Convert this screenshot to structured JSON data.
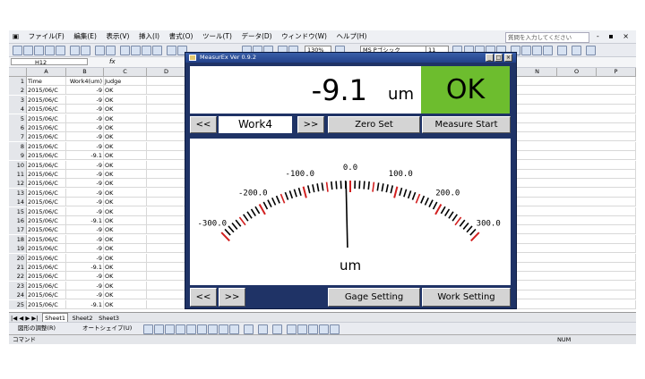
{
  "excel": {
    "menu": [
      "ファイル(F)",
      "編集(E)",
      "表示(V)",
      "挿入(I)",
      "書式(O)",
      "ツール(T)",
      "データ(D)",
      "ウィンドウ(W)",
      "ヘルプ(H)"
    ],
    "help_placeholder": "質問を入力してください",
    "window_controls": "- ▪ ×",
    "zoom": "130%",
    "font_name": "MS Pゴシック",
    "font_size": "11",
    "name_box": "H12",
    "fx_label": "fx",
    "columns": [
      "A",
      "B",
      "C",
      "D",
      "N",
      "O",
      "P"
    ],
    "rows": [
      {
        "n": "1",
        "a": "Time",
        "b": "Work4(um)",
        "c": "Judge"
      },
      {
        "n": "2",
        "a": "2015/06/C",
        "b": "-9",
        "c": "OK"
      },
      {
        "n": "3",
        "a": "2015/06/C",
        "b": "-9",
        "c": "OK"
      },
      {
        "n": "4",
        "a": "2015/06/C",
        "b": "-9",
        "c": "OK"
      },
      {
        "n": "5",
        "a": "2015/06/C",
        "b": "-9",
        "c": "OK"
      },
      {
        "n": "6",
        "a": "2015/06/C",
        "b": "-9",
        "c": "OK"
      },
      {
        "n": "7",
        "a": "2015/06/C",
        "b": "-9",
        "c": "OK"
      },
      {
        "n": "8",
        "a": "2015/06/C",
        "b": "-9",
        "c": "OK"
      },
      {
        "n": "9",
        "a": "2015/06/C",
        "b": "-9.1",
        "c": "OK"
      },
      {
        "n": "10",
        "a": "2015/06/C",
        "b": "-9",
        "c": "OK"
      },
      {
        "n": "11",
        "a": "2015/06/C",
        "b": "-9",
        "c": "OK"
      },
      {
        "n": "12",
        "a": "2015/06/C",
        "b": "-9",
        "c": "OK"
      },
      {
        "n": "13",
        "a": "2015/06/C",
        "b": "-9",
        "c": "OK"
      },
      {
        "n": "14",
        "a": "2015/06/C",
        "b": "-9",
        "c": "OK"
      },
      {
        "n": "15",
        "a": "2015/06/C",
        "b": "-9",
        "c": "OK"
      },
      {
        "n": "16",
        "a": "2015/06/C",
        "b": "-9.1",
        "c": "OK"
      },
      {
        "n": "17",
        "a": "2015/06/C",
        "b": "-9",
        "c": "OK"
      },
      {
        "n": "18",
        "a": "2015/06/C",
        "b": "-9",
        "c": "OK"
      },
      {
        "n": "19",
        "a": "2015/06/C",
        "b": "-9",
        "c": "OK"
      },
      {
        "n": "20",
        "a": "2015/06/C",
        "b": "-9",
        "c": "OK"
      },
      {
        "n": "21",
        "a": "2015/06/C",
        "b": "-9.1",
        "c": "OK"
      },
      {
        "n": "22",
        "a": "2015/06/C",
        "b": "-9",
        "c": "OK"
      },
      {
        "n": "23",
        "a": "2015/06/C",
        "b": "-9",
        "c": "OK"
      },
      {
        "n": "24",
        "a": "2015/06/C",
        "b": "-9",
        "c": "OK"
      },
      {
        "n": "25",
        "a": "2015/06/C",
        "b": "-9.1",
        "c": "OK"
      }
    ],
    "sheet_nav": "|◀ ◀ ▶ ▶|",
    "sheets": [
      "Sheet1",
      "Sheet2",
      "Sheet3"
    ],
    "draw_label": "図形の調整(R)",
    "autoshape_label": "オートシェイプ(U)",
    "status_left": "コマンド",
    "status_right": "NUM"
  },
  "app": {
    "title": "MeasurEx Ver 0.9.2",
    "value": "-9.1",
    "unit": "um",
    "judge": "OK",
    "prev_label": "<<",
    "next_label": ">>",
    "work_name": "Work4",
    "zero_set_label": "Zero Set",
    "measure_start_label": "Measure Start",
    "gage_setting_label": "Gage Setting",
    "work_setting_label": "Work Setting",
    "gauge": {
      "min": -300,
      "max": 300,
      "reading": -9.1,
      "unit": "um",
      "labels": [
        "-300.0",
        "-200.0",
        "-100.0",
        "0.0",
        "100.0",
        "200.0",
        "300.0"
      ],
      "label_values": [
        -300,
        -200,
        -100,
        0,
        100,
        200,
        300
      ],
      "major_color": "#d22020",
      "minor_color": "#000000"
    },
    "colors": {
      "frame": "#1f3366",
      "ok": "#6dbd2e"
    }
  }
}
